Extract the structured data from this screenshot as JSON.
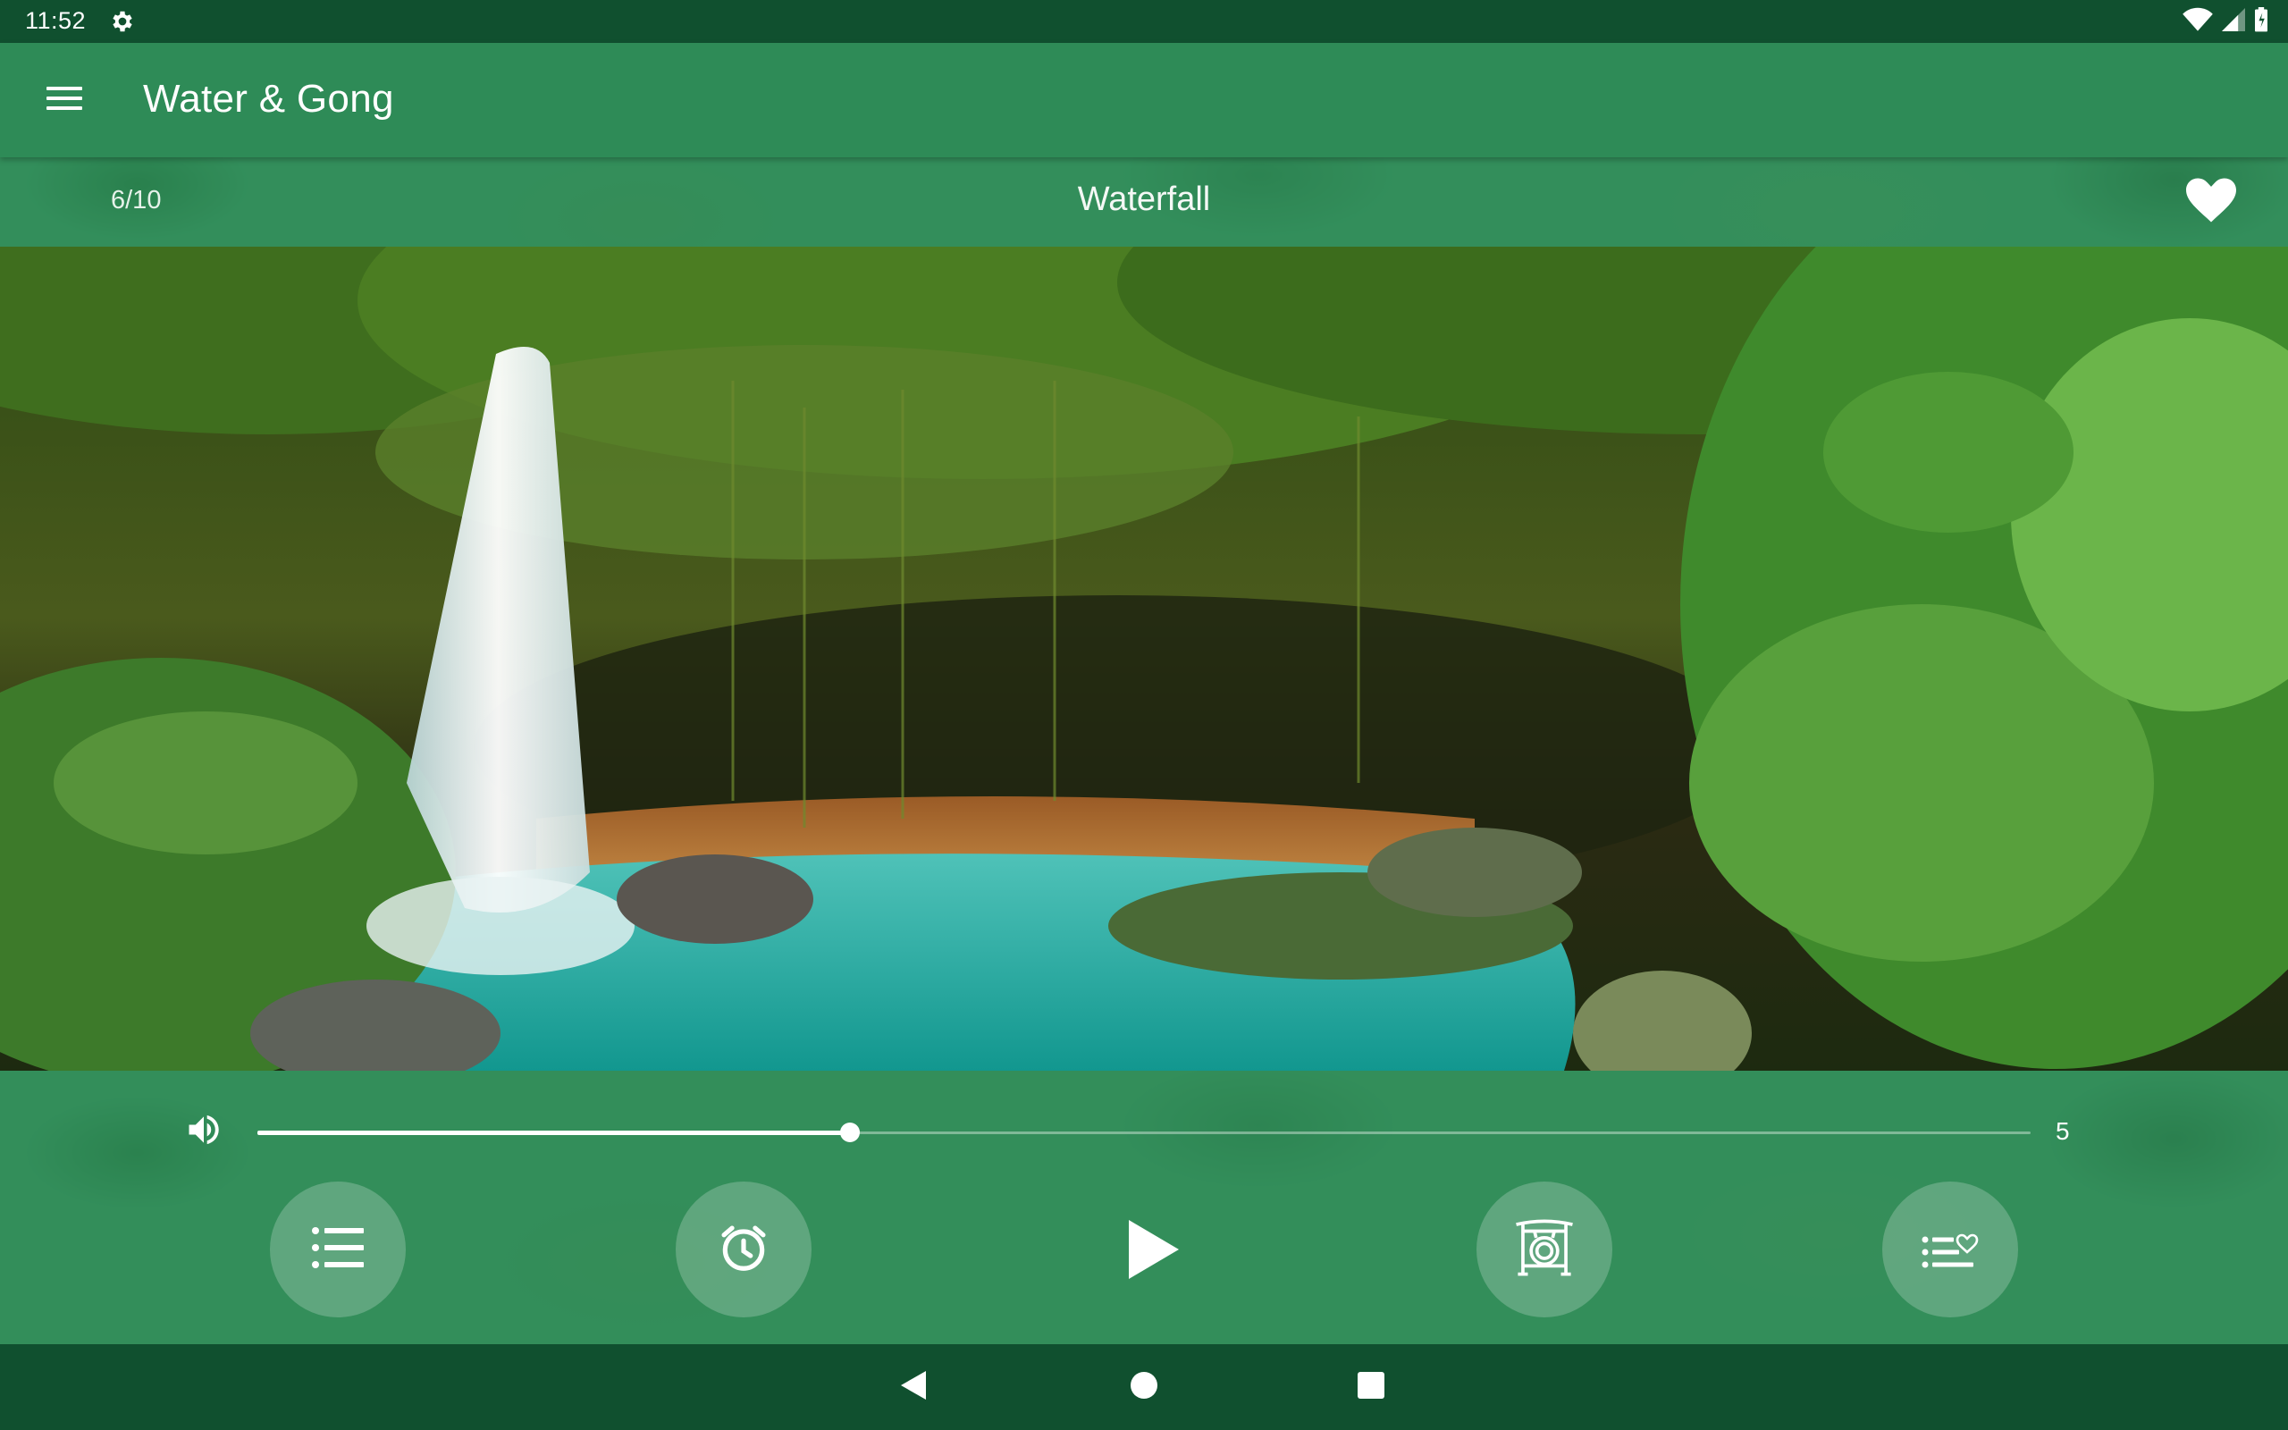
{
  "status_bar": {
    "time": "11:52",
    "icons": [
      "settings-gear-icon",
      "wifi-icon",
      "cell-signal-icon",
      "battery-icon"
    ]
  },
  "app_bar": {
    "title": "Water & Gong",
    "menu_icon": "hamburger-menu-icon"
  },
  "track": {
    "index": "6/10",
    "title": "Waterfall",
    "favorite": true,
    "favorite_icon": "heart-icon"
  },
  "player": {
    "volume_icon": "volume-icon",
    "volume_fraction": 0.334,
    "volume_value": "5",
    "buttons": [
      {
        "name": "playlist-button",
        "icon": "list-icon"
      },
      {
        "name": "alarm-timer-button",
        "icon": "alarm-clock-icon"
      },
      {
        "name": "play-button",
        "icon": "play-icon"
      },
      {
        "name": "gong-button",
        "icon": "gong-icon"
      },
      {
        "name": "favorites-list-button",
        "icon": "favorites-list-icon"
      }
    ]
  },
  "nav_bar": {
    "icons": [
      "back-icon",
      "home-icon",
      "recents-icon"
    ]
  },
  "colors": {
    "status_bar": "#10502f",
    "app_bar": "#2e8b57",
    "accent": "#ffffff",
    "water": "#2bb5b0"
  }
}
